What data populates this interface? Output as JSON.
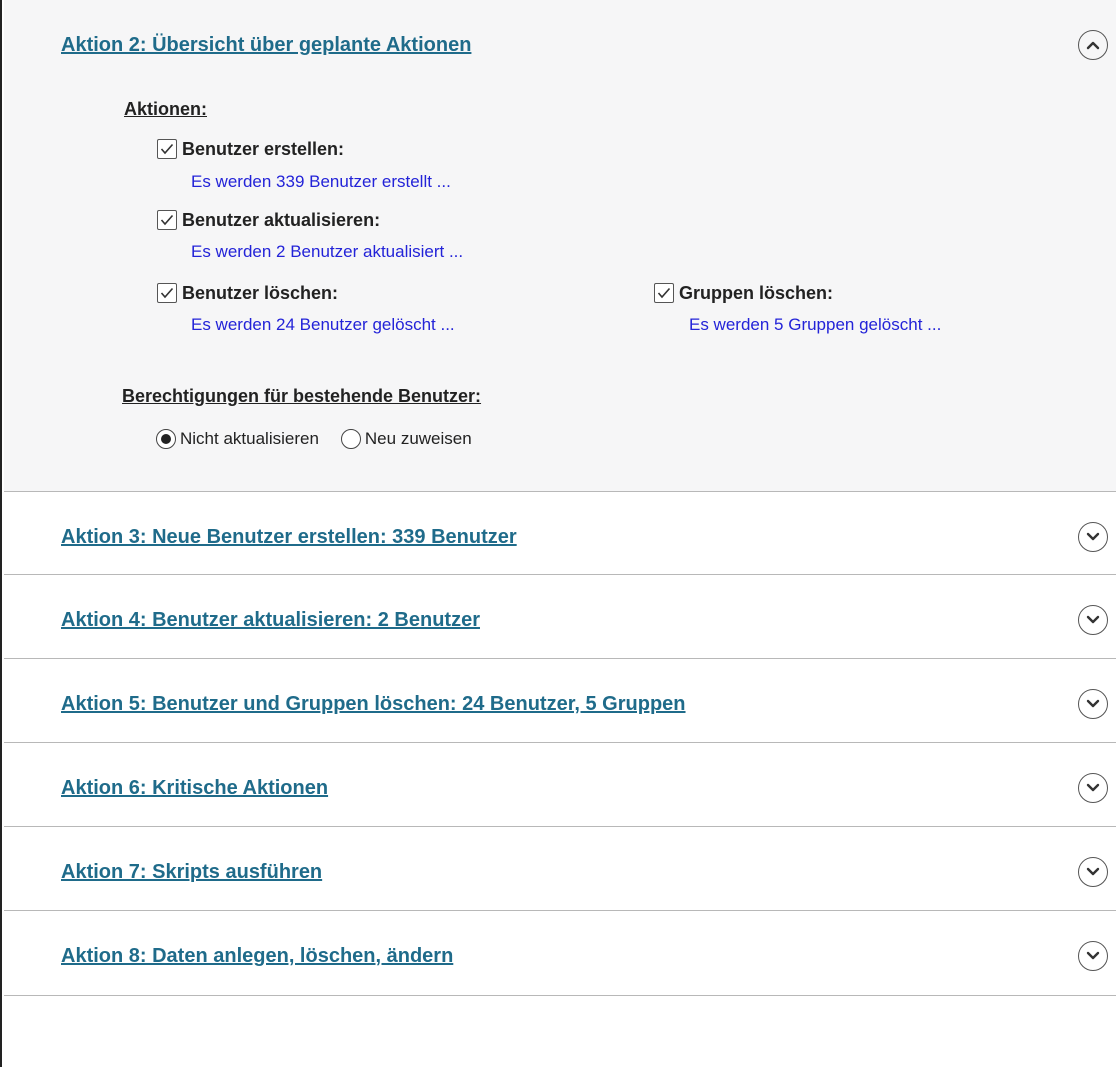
{
  "sections": [
    {
      "title": "Aktion 2: Übersicht über geplante Aktionen",
      "expanded": true,
      "actions_heading": "Aktionen:",
      "actions": [
        {
          "label": "Benutzer erstellen:",
          "checked": true,
          "description": "Es werden 339 Benutzer erstellt ..."
        },
        {
          "label": "Benutzer aktualisieren:",
          "checked": true,
          "description": "Es werden 2 Benutzer aktualisiert ..."
        },
        {
          "label": "Benutzer löschen:",
          "checked": true,
          "description": "Es werden 24 Benutzer gelöscht ..."
        },
        {
          "label": "Gruppen löschen:",
          "checked": true,
          "description": "Es werden 5 Gruppen gelöscht ..."
        }
      ],
      "permissions_heading": "Berechtigungen für bestehende Benutzer:",
      "permission_options": [
        {
          "label": "Nicht aktualisieren",
          "selected": true
        },
        {
          "label": "Neu zuweisen",
          "selected": false
        }
      ]
    },
    {
      "title": "Aktion 3: Neue Benutzer erstellen: 339 Benutzer",
      "expanded": false
    },
    {
      "title": "Aktion 4: Benutzer aktualisieren: 2 Benutzer",
      "expanded": false
    },
    {
      "title": "Aktion 5: Benutzer und Gruppen löschen: 24 Benutzer, 5 Gruppen",
      "expanded": false
    },
    {
      "title": "Aktion 6: Kritische Aktionen",
      "expanded": false
    },
    {
      "title": "Aktion 7: Skripts ausführen",
      "expanded": false
    },
    {
      "title": "Aktion 8: Daten anlegen, löschen, ändern",
      "expanded": false
    }
  ],
  "colors": {
    "link": "#1f6b8a",
    "description": "#2323d8",
    "expanded_background": "#f6f6f7",
    "divider": "#b8b8b8"
  },
  "icons": {
    "expanded_toggle": "chevron-up-circle-icon",
    "collapsed_toggle": "chevron-down-circle-icon",
    "checkbox": "check-icon"
  }
}
